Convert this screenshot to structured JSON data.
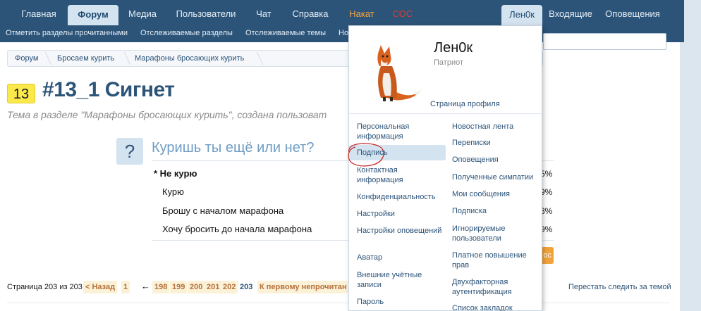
{
  "topnav": {
    "tabs": [
      {
        "label": "Главная"
      },
      {
        "label": "Форум"
      },
      {
        "label": "Медиа"
      },
      {
        "label": "Пользователи"
      },
      {
        "label": "Чат"
      },
      {
        "label": "Справка"
      },
      {
        "label": "Накат"
      },
      {
        "label": "СОС"
      },
      {
        "label": "Лен0к"
      },
      {
        "label": "Входящие"
      },
      {
        "label": "Оповещения"
      }
    ],
    "colors": {
      "bar": "#2c5479",
      "active_tab": "#d4e3f0",
      "nakat": "#f2a443",
      "sos": "#e03a2c"
    }
  },
  "subnav": {
    "links": [
      {
        "label": "Отметить разделы прочитанными"
      },
      {
        "label": "Отслеживаемые разделы"
      },
      {
        "label": "Отслеживаемые темы"
      },
      {
        "label": "Но"
      }
    ]
  },
  "breadcrumb": [
    {
      "label": "Форум"
    },
    {
      "label": "Бросаем курить"
    },
    {
      "label": "Марафоны бросающих курить"
    }
  ],
  "thread": {
    "badge": "13",
    "title": "#13_1 Сигнет",
    "subtitle": "Тема в разделе \"Марафоны бросающих курить\", создана пользоват"
  },
  "poll": {
    "icon": "?",
    "question": "Куришь ты ещё или нет?",
    "options": [
      {
        "label": "* Не курю",
        "pct": "5%"
      },
      {
        "label": "Курю",
        "pct": "9%"
      },
      {
        "label": "Брошу с началом марафона",
        "pct": "8%"
      },
      {
        "label": "Хочу бросить до начала марафона",
        "pct": "9%"
      }
    ],
    "vote_label": "ос"
  },
  "pagination": {
    "label": "Страница 203 из 203",
    "prev": "< Назад",
    "first": "1",
    "arrow": "←",
    "pages": [
      "198",
      "199",
      "200",
      "201",
      "202"
    ],
    "current": "203",
    "to_unread": "К первому непрочитан",
    "stop_follow": "Перестать следить за темой"
  },
  "user_menu": {
    "username": "Лен0к",
    "user_title": "Патриот",
    "profile_link": "Страница профиля",
    "left_items": [
      {
        "label": "Персональная информация"
      },
      {
        "label": "Подпись"
      },
      {
        "label": "Контактная информация"
      },
      {
        "label": "Конфиденциальность"
      },
      {
        "label": "Настройки"
      },
      {
        "label": "Настройки оповещений"
      },
      {
        "label": "Аватар"
      },
      {
        "label": "Внешние учётные записи"
      },
      {
        "label": "Пароль"
      }
    ],
    "right_items": [
      {
        "label": "Новостная лента"
      },
      {
        "label": "Переписки"
      },
      {
        "label": "Оповещения"
      },
      {
        "label": "Полученные симпатии"
      },
      {
        "label": "Мои сообщения"
      },
      {
        "label": "Подписка"
      },
      {
        "label": "Игнорируемые пользователи"
      },
      {
        "label": "Платное повышение прав"
      },
      {
        "label": "Двухфакторная аутентификация"
      },
      {
        "label": "Список закладок"
      }
    ],
    "highlighted_item": "Подпись",
    "avatar_icon": "fox-avatar-icon"
  }
}
